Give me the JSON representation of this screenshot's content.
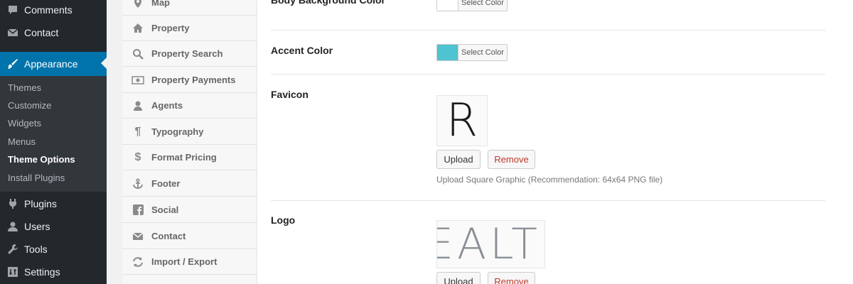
{
  "admin_menu": {
    "items": [
      {
        "label": "Comments",
        "icon": "comment-icon"
      },
      {
        "label": "Contact",
        "icon": "envelope-icon"
      },
      {
        "label": "Appearance",
        "icon": "paintbrush-icon"
      },
      {
        "label": "Plugins",
        "icon": "plug-icon"
      },
      {
        "label": "Users",
        "icon": "user-icon"
      },
      {
        "label": "Tools",
        "icon": "wrench-icon"
      },
      {
        "label": "Settings",
        "icon": "settings-icon"
      }
    ],
    "submenu": [
      "Themes",
      "Customize",
      "Widgets",
      "Menus",
      "Theme Options",
      "Install Plugins"
    ],
    "current_submenu": "Theme Options"
  },
  "options_nav": {
    "items": [
      {
        "label": "Map",
        "icon": "map-marker-icon"
      },
      {
        "label": "Property",
        "icon": "home-icon"
      },
      {
        "label": "Property Search",
        "icon": "search-icon"
      },
      {
        "label": "Property Payments",
        "icon": "money-icon"
      },
      {
        "label": "Agents",
        "icon": "user-icon"
      },
      {
        "label": "Typography",
        "icon": "paragraph-icon"
      },
      {
        "label": "Format Pricing",
        "icon": "dollar-icon"
      },
      {
        "label": "Footer",
        "icon": "anchor-icon"
      },
      {
        "label": "Social",
        "icon": "facebook-icon"
      },
      {
        "label": "Contact",
        "icon": "envelope-icon"
      },
      {
        "label": "Import / Export",
        "icon": "refresh-icon"
      }
    ]
  },
  "settings": {
    "body_bg": {
      "label": "Body Background Color",
      "button": "Select Color",
      "color": "#ffffff"
    },
    "accent": {
      "label": "Accent Color",
      "button": "Select Color",
      "color": "#4fc3cf"
    },
    "favicon": {
      "label": "Favicon",
      "preview_text": "R",
      "upload": "Upload",
      "remove": "Remove",
      "help": "Upload Square Graphic (Recommendation: 64x64 PNG file)"
    },
    "logo": {
      "label": "Logo",
      "preview_text": "EALT",
      "upload": "Upload",
      "remove": "Remove"
    }
  },
  "colors": {
    "admin_bg": "#23282d",
    "active": "#0073aa",
    "remove": "#c0392b"
  }
}
